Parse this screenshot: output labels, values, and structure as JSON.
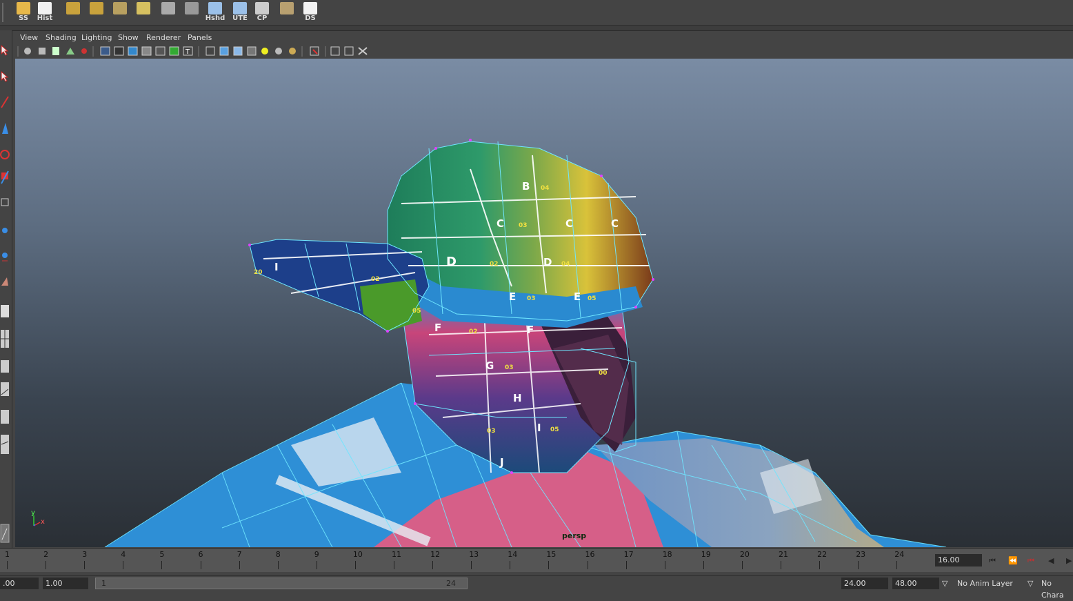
{
  "shelf": {
    "buttons": [
      {
        "label": "SS",
        "icon": "folder-icon"
      },
      {
        "label": "Hist",
        "icon": "history-edit-icon"
      },
      {
        "label": "",
        "icon": "poly-cube-icon"
      },
      {
        "label": "",
        "icon": "poly-cylinder-icon"
      },
      {
        "label": "",
        "icon": "poly-plane-icon"
      },
      {
        "label": "",
        "icon": "uv-grid-icon"
      },
      {
        "label": "",
        "icon": "checker-sphere-icon"
      },
      {
        "label": "",
        "icon": "normals-icon"
      },
      {
        "label": "Hshd",
        "icon": "hypershade-icon"
      },
      {
        "label": "UTE",
        "icon": "uv-editor-icon"
      },
      {
        "label": "CP",
        "icon": "center-pivot-icon"
      },
      {
        "label": "",
        "icon": "paint-weights-icon"
      },
      {
        "label": "DS",
        "icon": "delete-history-icon"
      }
    ]
  },
  "menu": [
    "View",
    "Shading",
    "Lighting",
    "Show",
    "Renderer",
    "Panels"
  ],
  "viewport": {
    "camera": "persp",
    "axis_y": "y",
    "axis_x": "x"
  },
  "timeline": {
    "ticks": [
      "1",
      "2",
      "3",
      "4",
      "5",
      "6",
      "7",
      "8",
      "9",
      "10",
      "11",
      "12",
      "13",
      "14",
      "15",
      "16",
      "17",
      "18",
      "19",
      "20",
      "21",
      "22",
      "23",
      "24"
    ],
    "current_frame": "16.00"
  },
  "range": {
    "start": ".00",
    "playback_start": "1.00",
    "bar_start": "1",
    "bar_end": "24",
    "playback_end": "24.00",
    "end": "48.00",
    "anim_layer": "No Anim Layer",
    "character": "No Chara"
  },
  "uv_letters": [
    "B",
    "C",
    "C",
    "C",
    "D",
    "D",
    "E",
    "E",
    "F",
    "F",
    "G",
    "H",
    "I",
    "J",
    "I"
  ],
  "uv_numbers": [
    "04",
    "03",
    "02",
    "04",
    "03",
    "05",
    "02",
    "03",
    "05",
    "03",
    "20",
    "02",
    "05",
    "00"
  ]
}
